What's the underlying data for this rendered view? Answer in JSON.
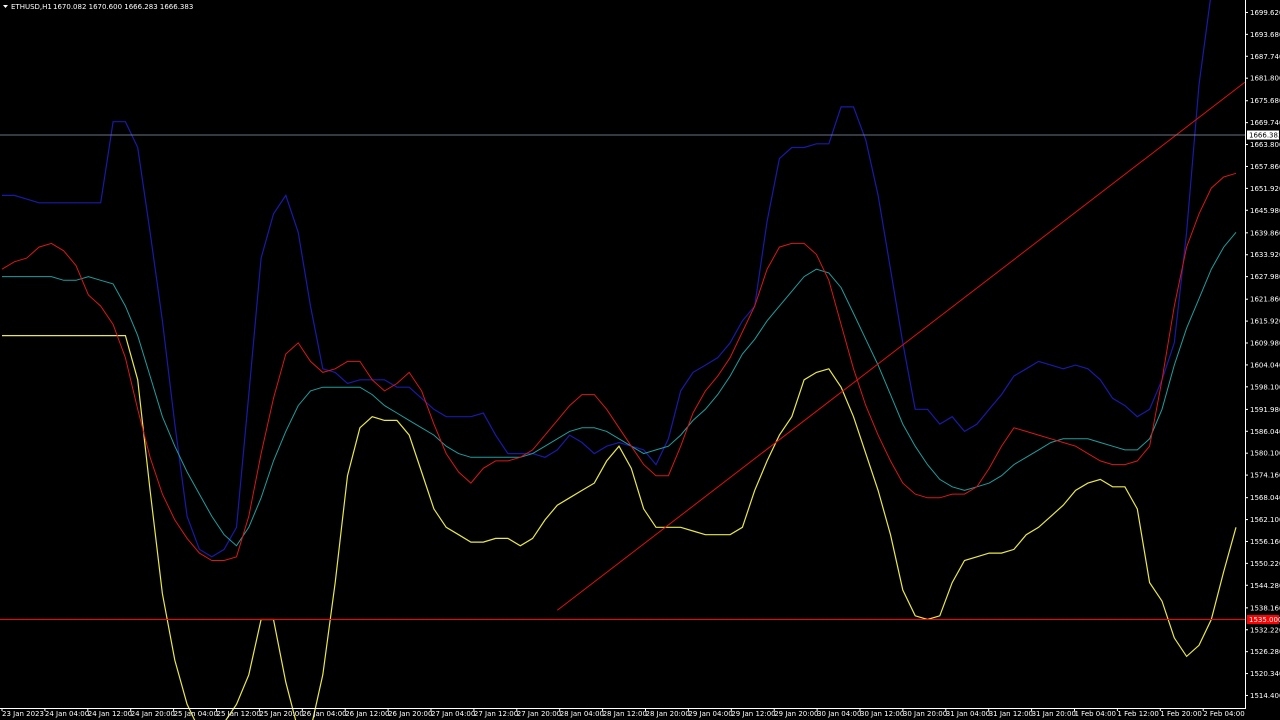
{
  "header": {
    "symbol": "ETHUSD,H1",
    "ohlc": "1670.082 1670.600 1666.283 1666.383"
  },
  "colors": {
    "background": "#000000",
    "axis": "#ffffff",
    "bull_candle": "#8fe56b",
    "bear_candle": "#ff0000",
    "doji_candle": "#ffffff",
    "bollinger_upper": "#1a1aa8",
    "bollinger_lower": "#e8e84a",
    "ma_fast": "#d81818",
    "ma_slow": "#1f9e9e",
    "trendline": "#e01010",
    "bid_line": "#8a9aaa",
    "support_line": "#ff0000"
  },
  "chart_data": {
    "type": "candlestick",
    "ylim": [
      1511.0,
      1703.0
    ],
    "y_ticks": [
      1699.62,
      1693.68,
      1687.74,
      1681.8,
      1675.68,
      1669.74,
      1663.8,
      1657.86,
      1651.92,
      1645.98,
      1639.86,
      1633.92,
      1627.98,
      1621.86,
      1615.92,
      1609.98,
      1604.04,
      1598.1,
      1591.98,
      1586.04,
      1580.1,
      1574.16,
      1568.04,
      1562.1,
      1556.16,
      1550.22,
      1544.28,
      1538.16,
      1532.22,
      1526.28,
      1520.34,
      1514.4
    ],
    "x_ticks": [
      "23 Jan 2023",
      "24 Jan 04:00",
      "24 Jan 12:00",
      "24 Jan 20:00",
      "25 Jan 04:00",
      "25 Jan 12:00",
      "25 Jan 20:00",
      "26 Jan 04:00",
      "26 Jan 12:00",
      "26 Jan 20:00",
      "27 Jan 04:00",
      "27 Jan 12:00",
      "27 Jan 20:00",
      "28 Jan 04:00",
      "28 Jan 12:00",
      "28 Jan 20:00",
      "29 Jan 04:00",
      "29 Jan 12:00",
      "29 Jan 20:00",
      "30 Jan 04:00",
      "30 Jan 12:00",
      "30 Jan 20:00",
      "31 Jan 04:00",
      "31 Jan 12:00",
      "31 Jan 20:00",
      "1 Feb 04:00",
      "1 Feb 12:00",
      "1 Feb 20:00",
      "2 Feb 04:00"
    ],
    "current_price": 1666.383,
    "current_price_label": "1666.383",
    "support_price": 1535.0,
    "support_price_label": "1535.000",
    "bollinger_upper": [
      1650,
      1650,
      1649,
      1648,
      1648,
      1648,
      1648,
      1648,
      1648,
      1670,
      1670,
      1663,
      1640,
      1616,
      1588,
      1563,
      1554,
      1552,
      1554,
      1560,
      1596,
      1633,
      1645,
      1650,
      1640,
      1620,
      1603,
      1602,
      1599,
      1600,
      1600,
      1600,
      1598,
      1598,
      1595,
      1592,
      1590,
      1590,
      1590,
      1591,
      1585,
      1580,
      1580,
      1580,
      1579,
      1581,
      1585,
      1583,
      1580,
      1582,
      1583,
      1582,
      1581,
      1577,
      1584,
      1597,
      1602,
      1604,
      1606,
      1610,
      1616,
      1620,
      1643,
      1660,
      1663,
      1663,
      1664,
      1664,
      1674,
      1674,
      1665,
      1650,
      1630,
      1610,
      1592,
      1592,
      1588,
      1590,
      1586,
      1588,
      1592,
      1596,
      1601,
      1603,
      1605,
      1604,
      1603,
      1604,
      1603,
      1600,
      1595,
      1593,
      1590,
      1592,
      1600,
      1610,
      1640,
      1680,
      1705,
      1708,
      1708
    ],
    "bollinger_lower": [
      1612,
      1612,
      1612,
      1612,
      1612,
      1612,
      1612,
      1612,
      1612,
      1612,
      1612,
      1600,
      1570,
      1542,
      1524,
      1512,
      1505,
      1505,
      1507,
      1512,
      1520,
      1535,
      1535,
      1518,
      1505,
      1505,
      1520,
      1545,
      1574,
      1587,
      1590,
      1589,
      1589,
      1585,
      1575,
      1565,
      1560,
      1558,
      1556,
      1556,
      1557,
      1557,
      1555,
      1557,
      1562,
      1566,
      1568,
      1570,
      1572,
      1578,
      1582,
      1576,
      1565,
      1560,
      1560,
      1560,
      1559,
      1558,
      1558,
      1558,
      1560,
      1570,
      1578,
      1585,
      1590,
      1600,
      1602,
      1603,
      1598,
      1590,
      1580,
      1570,
      1558,
      1543,
      1536,
      1535,
      1536,
      1545,
      1551,
      1552,
      1553,
      1553,
      1554,
      1558,
      1560,
      1563,
      1566,
      1570,
      1572,
      1573,
      1571,
      1571,
      1565,
      1545,
      1540,
      1530,
      1525,
      1528,
      1535,
      1548,
      1560
    ],
    "ma_fast": [
      1630,
      1632,
      1633,
      1636,
      1637,
      1635,
      1631,
      1623,
      1620,
      1615,
      1606,
      1592,
      1579,
      1569,
      1562,
      1557,
      1553,
      1551,
      1551,
      1552,
      1563,
      1580,
      1595,
      1607,
      1610,
      1605,
      1602,
      1603,
      1605,
      1605,
      1600,
      1597,
      1599,
      1602,
      1597,
      1588,
      1580,
      1575,
      1572,
      1576,
      1578,
      1578,
      1579,
      1581,
      1585,
      1589,
      1593,
      1596,
      1596,
      1592,
      1587,
      1582,
      1577,
      1574,
      1574,
      1582,
      1591,
      1597,
      1601,
      1606,
      1613,
      1620,
      1630,
      1636,
      1637,
      1637,
      1634,
      1627,
      1615,
      1603,
      1593,
      1585,
      1578,
      1572,
      1569,
      1568,
      1568,
      1569,
      1569,
      1571,
      1576,
      1582,
      1587,
      1586,
      1585,
      1584,
      1583,
      1582,
      1580,
      1578,
      1577,
      1577,
      1578,
      1582,
      1600,
      1620,
      1636,
      1645,
      1652,
      1655,
      1656
    ],
    "ma_slow": [
      1628,
      1628,
      1628,
      1628,
      1628,
      1627,
      1627,
      1628,
      1627,
      1626,
      1620,
      1612,
      1601,
      1590,
      1582,
      1575,
      1569,
      1563,
      1558,
      1555,
      1560,
      1568,
      1578,
      1586,
      1593,
      1597,
      1598,
      1598,
      1598,
      1598,
      1596,
      1593,
      1591,
      1589,
      1587,
      1585,
      1582,
      1580,
      1579,
      1579,
      1579,
      1579,
      1579,
      1580,
      1582,
      1584,
      1586,
      1587,
      1587,
      1586,
      1584,
      1582,
      1580,
      1581,
      1582,
      1585,
      1589,
      1592,
      1596,
      1601,
      1607,
      1611,
      1616,
      1620,
      1624,
      1628,
      1630,
      1629,
      1625,
      1618,
      1611,
      1604,
      1596,
      1588,
      1582,
      1577,
      1573,
      1571,
      1570,
      1571,
      1572,
      1574,
      1577,
      1579,
      1581,
      1583,
      1584,
      1584,
      1584,
      1583,
      1582,
      1581,
      1581,
      1584,
      1592,
      1604,
      1614,
      1622,
      1630,
      1636,
      1640
    ],
    "trendline": {
      "from": [
        45,
        1537.5
      ],
      "to": [
        102,
        1684
      ]
    }
  }
}
